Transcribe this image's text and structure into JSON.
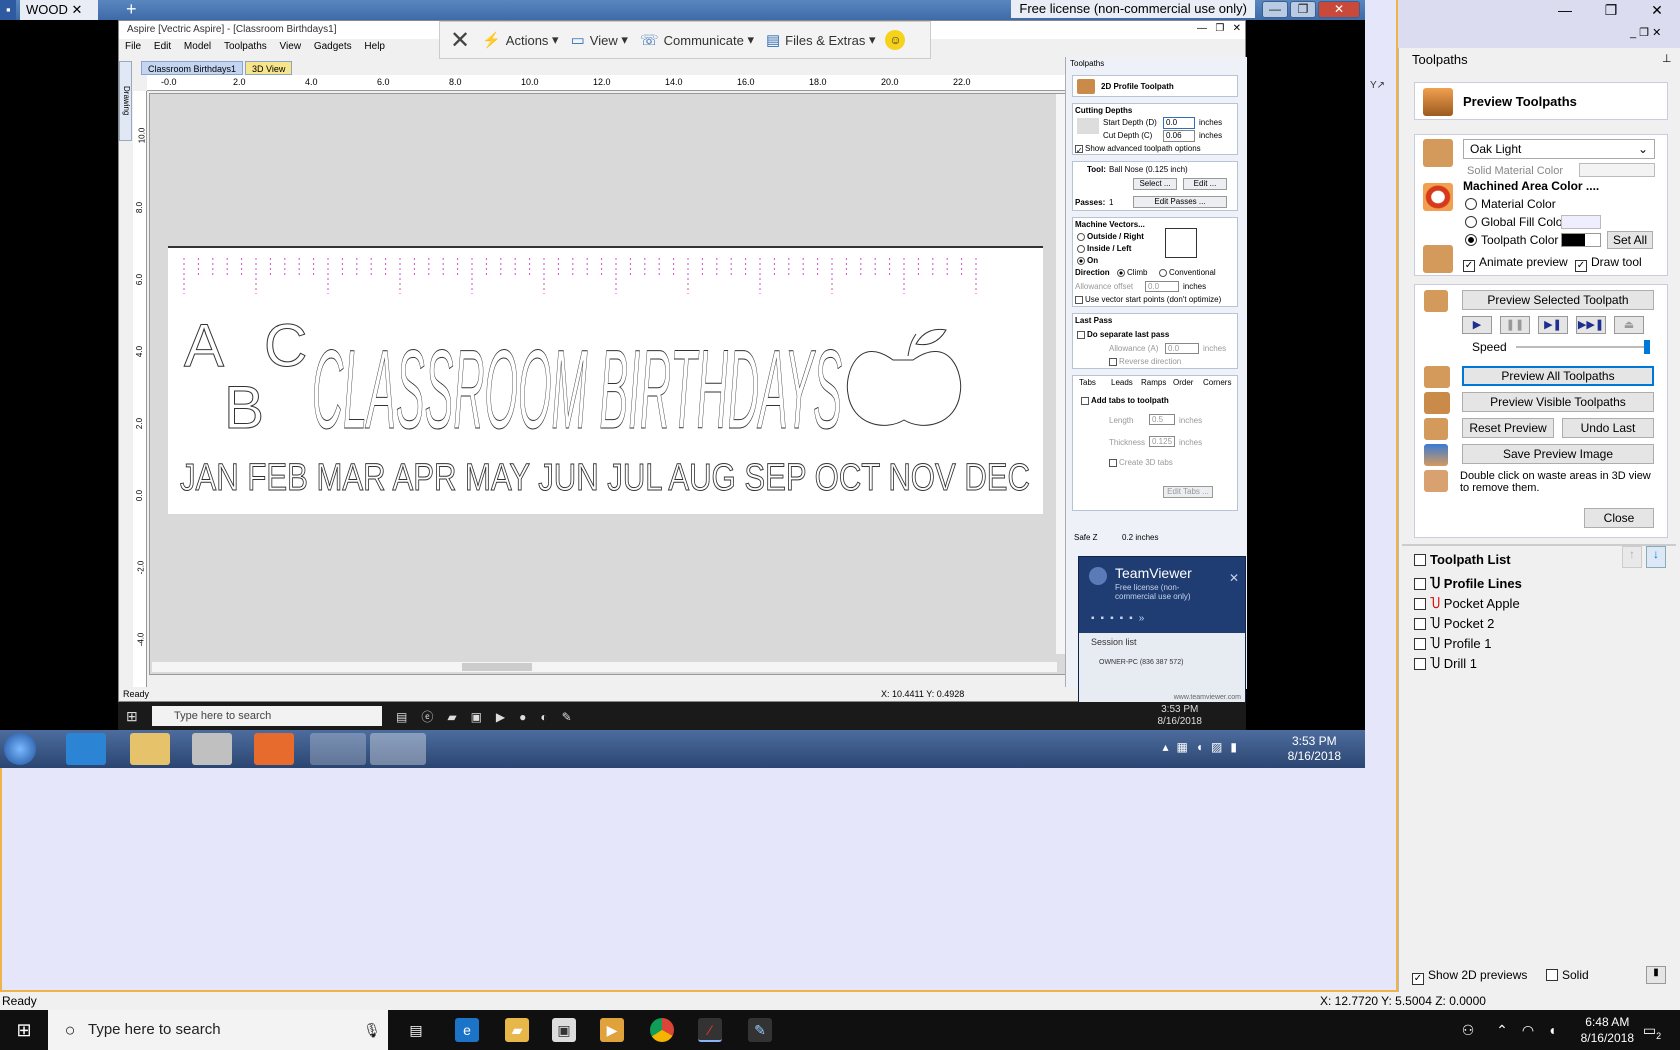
{
  "remote": {
    "tab_label": "WOOD",
    "license": "Free license (non-commercial use only)",
    "aspire_title": "Aspire [Vectric Aspire] - [Classroom Birthdays1]",
    "menu": [
      "File",
      "Edit",
      "Model",
      "Toolpaths",
      "View",
      "Gadgets",
      "Help"
    ],
    "doc_tabs": [
      "Classroom Birthdays1",
      "3D View"
    ],
    "drawing_tab": "Drawing",
    "ruler_top": [
      "-0.0",
      "2.0",
      "4.0",
      "6.0",
      "8.0",
      "10.0",
      "12.0",
      "14.0",
      "16.0",
      "18.0",
      "20.0",
      "22.0"
    ],
    "ruler_left": [
      "10.0",
      "8.0",
      "6.0",
      "4.0",
      "2.0",
      "0.0",
      "-2.0",
      "-4.0"
    ],
    "status": "Ready",
    "status_coords": "X: 10.4411 Y: 0.4928",
    "design": {
      "line1": "CLASSROOM BIRTHDAYS",
      "letters": [
        "A",
        "B",
        "C"
      ],
      "months": "JAN FEB MAR APR MAY JUN JUL AUG SEP OCT NOV DEC"
    },
    "tv_toolbar": {
      "actions": "Actions",
      "view": "View",
      "communicate": "Communicate",
      "files": "Files & Extras"
    },
    "panel": {
      "title": "Toolpaths",
      "header": "2D Profile Toolpath",
      "cutting_depths": "Cutting Depths",
      "start_depth_label": "Start Depth (D)",
      "start_depth_value": "0.0",
      "cut_depth_label": "Cut Depth (C)",
      "cut_depth_value": "0.06",
      "unit": "inches",
      "advanced": "Show advanced toolpath options",
      "tool_label": "Tool:",
      "tool_value": "Ball Nose (0.125 inch)",
      "select_btn": "Select ...",
      "edit_btn": "Edit ...",
      "passes_label": "Passes:",
      "passes_value": "1",
      "edit_passes_btn": "Edit Passes ...",
      "machine_vectors": "Machine Vectors...",
      "outside_right": "Outside / Right",
      "inside_left": "Inside / Left",
      "on": "On",
      "direction": "Direction",
      "climb": "Climb",
      "conventional": "Conventional",
      "allowance_offset": "Allowance offset",
      "allowance_value": "0.0",
      "vector_start": "Use vector start points (don't optimize)",
      "last_pass": "Last Pass",
      "separate_last": "Do separate last pass",
      "allowance_a": "Allowance (A)",
      "reverse": "Reverse direction",
      "tabs": [
        "Tabs",
        "Leads",
        "Ramps",
        "Order",
        "Corners"
      ],
      "add_tabs": "Add tabs to toolpath",
      "length": "Length",
      "length_value": "0.5",
      "thickness": "Thickness",
      "thickness_value": "0.125",
      "create_3d": "Create 3D tabs",
      "edit_tabs_btn": "Edit Tabs ...",
      "safe_z": "Safe Z",
      "safe_z_value": "0.2 inches"
    },
    "teamviewer": {
      "name": "TeamViewer",
      "license": "Free license (non-commercial use only)",
      "session_list": "Session list",
      "session_item": "OWNER-PC (836 387 572)",
      "url": "www.teamviewer.com"
    },
    "win10_search": "Type here to search",
    "win10_time": "3:53 PM",
    "win10_date": "8/16/2018",
    "win7_time": "3:53 PM",
    "win7_date": "8/16/2018"
  },
  "local": {
    "panel_title": "Toolpaths",
    "preview_title": "Preview Toolpaths",
    "material": "Oak Light",
    "solid_material_color": "Solid Material Color",
    "machined_area_color": "Machined Area Color ....",
    "material_color": "Material Color",
    "global_fill_color": "Global Fill Color",
    "toolpath_color": "Toolpath Color",
    "set_all": "Set All",
    "animate_preview": "Animate preview",
    "draw_tool": "Draw tool",
    "preview_selected": "Preview Selected Toolpath",
    "speed": "Speed",
    "preview_all": "Preview All Toolpaths",
    "preview_visible": "Preview Visible Toolpaths",
    "reset_preview": "Reset Preview",
    "undo_last": "Undo Last",
    "save_preview_image": "Save Preview Image",
    "hint": "Double click on waste areas in 3D view to remove them.",
    "close": "Close",
    "toolpath_list_title": "Toolpath List",
    "toolpaths": [
      "Profile Lines",
      "Pocket Apple",
      "Pocket 2",
      "Profile 1",
      "Drill 1"
    ],
    "show_2d_previews": "Show 2D previews",
    "solid": "Solid",
    "status": "Ready",
    "status_coords": "X: 12.7720 Y: 5.5004 Z: 0.0000",
    "search_placeholder": "Type here to search",
    "time": "6:48 AM",
    "date": "8/16/2018",
    "notification_count": "2"
  },
  "colors": {
    "accent": "#0078d7",
    "remote_title": "#3e6aa8",
    "tv_popup": "#1f3c73",
    "guide_marks": "#d04cc8",
    "border_highlight": "#f0b34a"
  }
}
